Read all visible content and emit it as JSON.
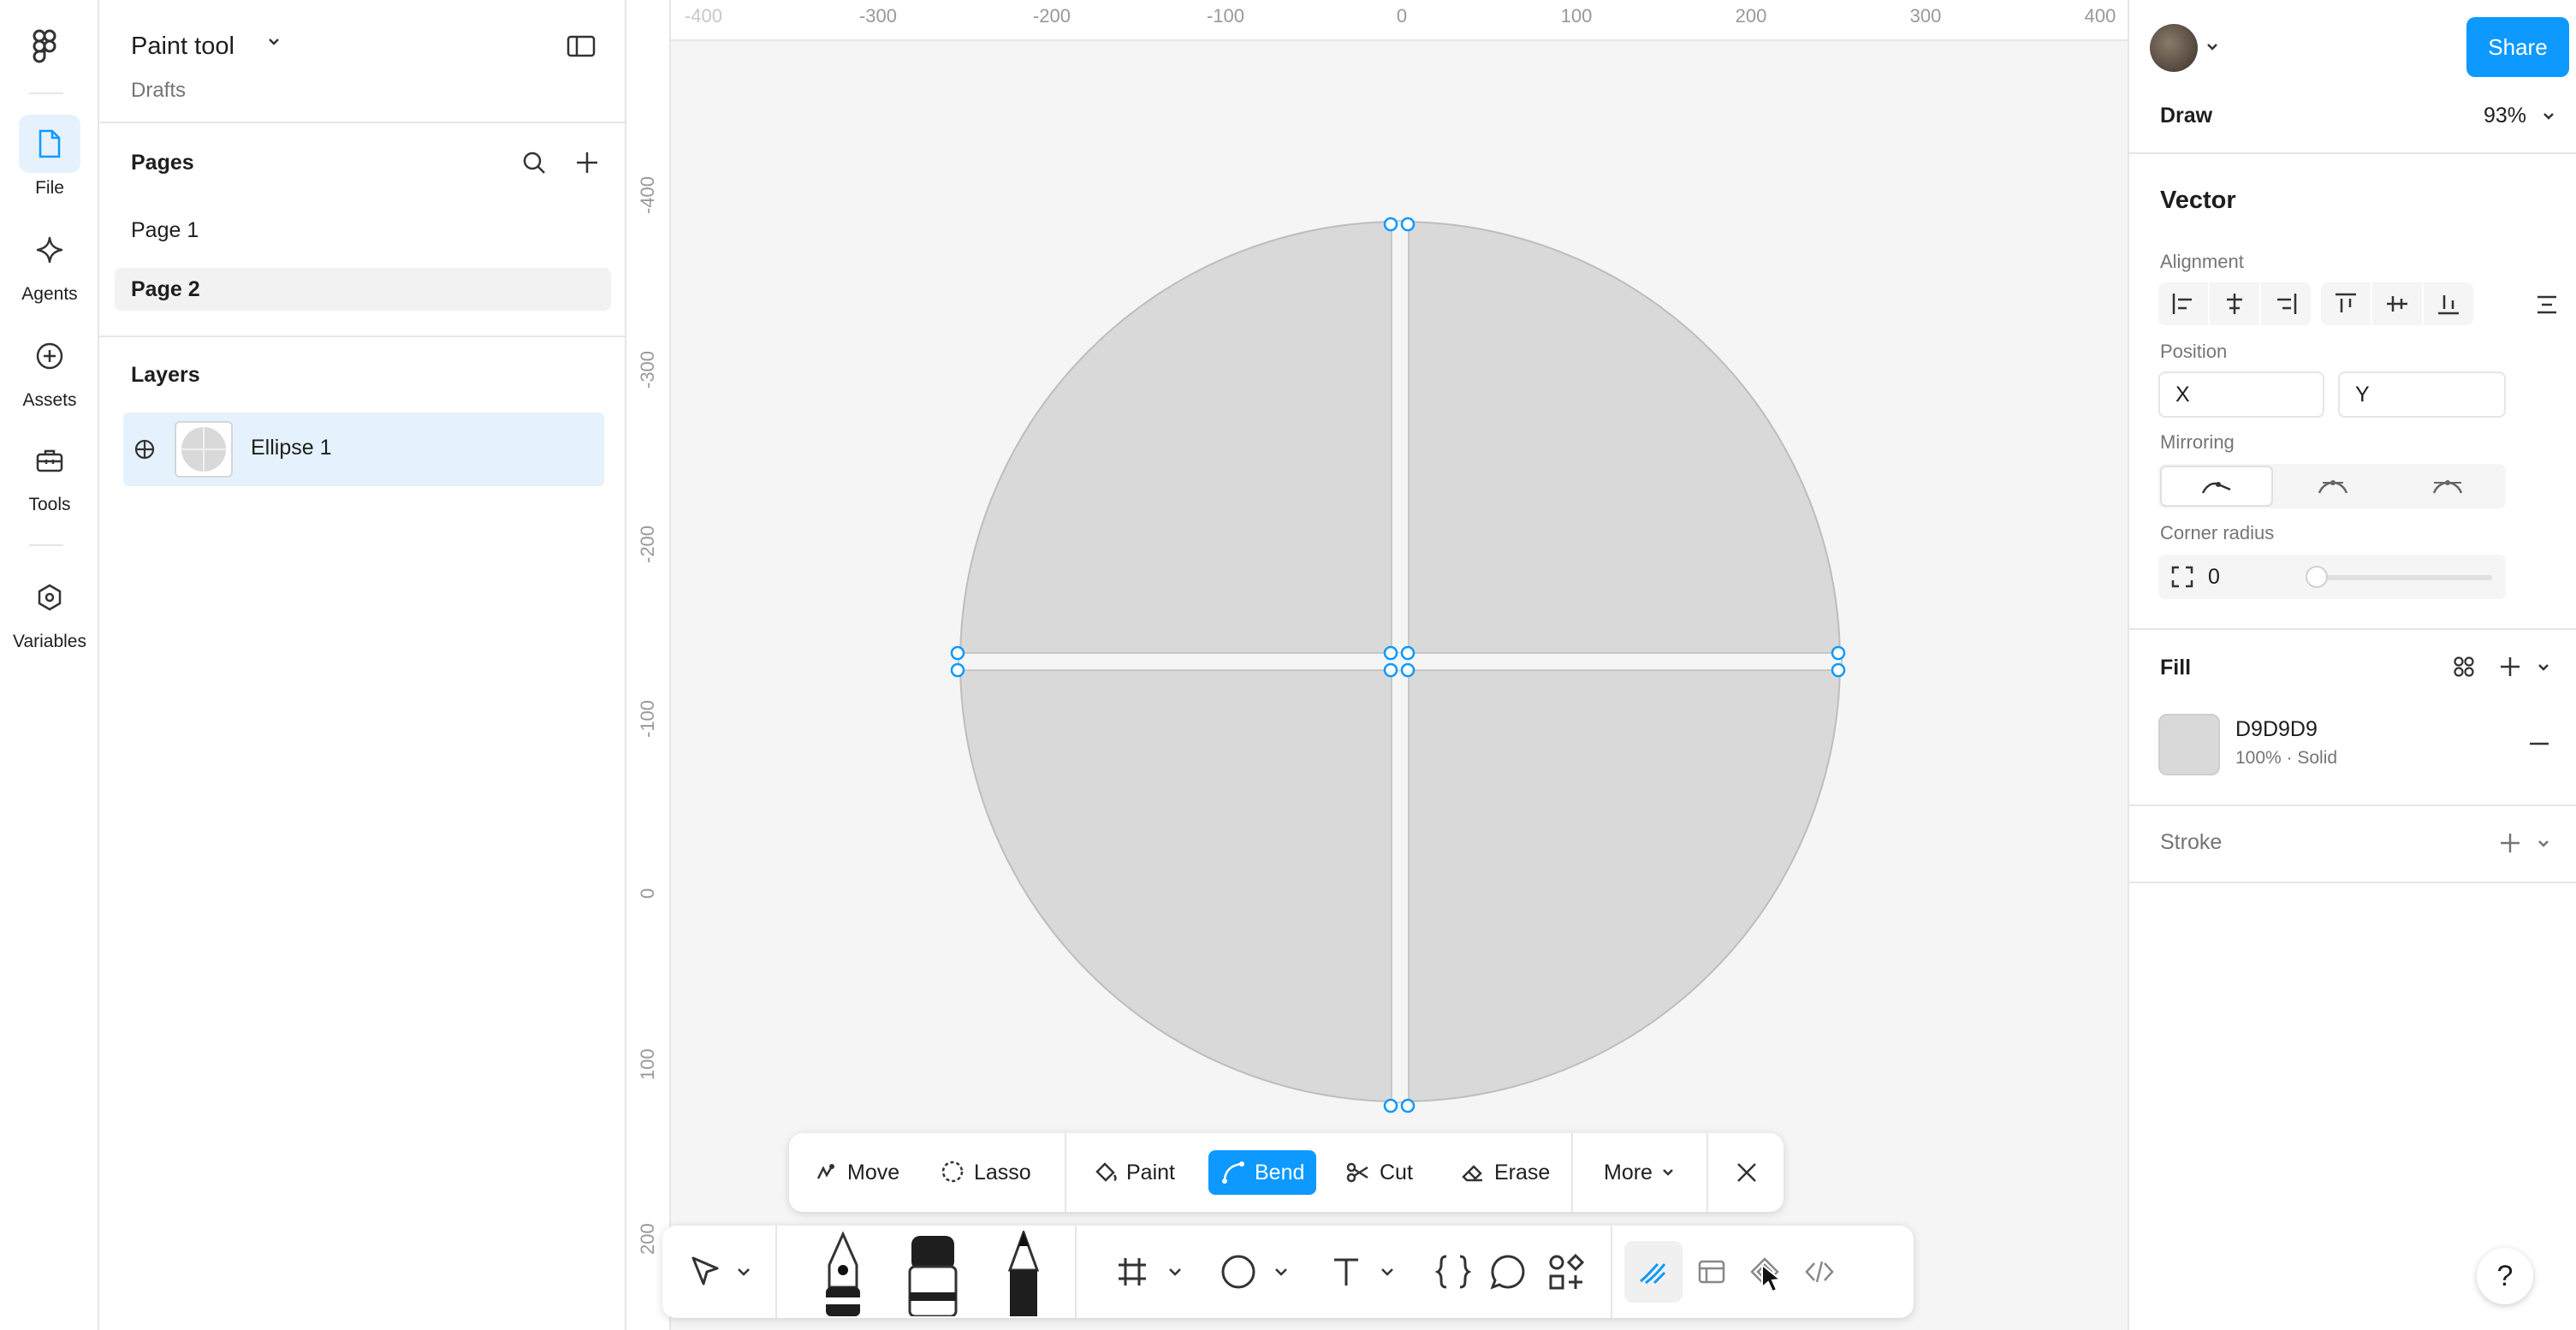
{
  "app": {
    "file_title": "Paint tool",
    "file_location": "Drafts"
  },
  "rail": {
    "items": [
      {
        "label": "File",
        "icon": "file-icon"
      },
      {
        "label": "Agents",
        "icon": "sparkle-icon"
      },
      {
        "label": "Assets",
        "icon": "plus-circle-icon"
      },
      {
        "label": "Tools",
        "icon": "toolbox-icon"
      },
      {
        "label": "Variables",
        "icon": "hexagon-icon"
      }
    ]
  },
  "pages": {
    "title": "Pages",
    "items": [
      {
        "label": "Page 1",
        "selected": false
      },
      {
        "label": "Page 2",
        "selected": true
      }
    ]
  },
  "layers": {
    "title": "Layers",
    "items": [
      {
        "label": "Ellipse 1",
        "selected": true
      }
    ]
  },
  "rulers": {
    "top": [
      "-400",
      "-300",
      "-200",
      "-100",
      "0",
      "100",
      "200",
      "300",
      "400"
    ],
    "left": [
      "-400",
      "-300",
      "-200",
      "-100",
      "0",
      "100",
      "200"
    ]
  },
  "vector_toolbar": {
    "items": [
      {
        "label": "Move",
        "icon": "move-icon",
        "active": false
      },
      {
        "label": "Lasso",
        "icon": "lasso-icon",
        "active": false
      },
      {
        "label": "Paint",
        "icon": "paint-bucket-icon",
        "active": false
      },
      {
        "label": "Bend",
        "icon": "bend-icon",
        "active": true
      },
      {
        "label": "Cut",
        "icon": "scissors-icon",
        "active": false
      },
      {
        "label": "Erase",
        "icon": "eraser-icon",
        "active": false
      },
      {
        "label": "More",
        "icon": "chevron-down-icon",
        "active": false
      }
    ]
  },
  "bottom_toolbar": {
    "tools": [
      "move-arrow-icon",
      "pen-icon",
      "marker-icon",
      "pencil-icon",
      "frame-icon",
      "ellipse-icon",
      "text-icon",
      "braces-icon",
      "comment-icon",
      "components-icon",
      "draw-mode-icon",
      "design-mode-icon",
      "prototype-icon",
      "dev-mode-icon"
    ]
  },
  "right_panel": {
    "share_label": "Share",
    "mode_label": "Draw",
    "zoom": "93%",
    "section_title": "Vector",
    "alignment_label": "Alignment",
    "position_label": "Position",
    "x_placeholder": "X",
    "y_placeholder": "Y",
    "mirroring_label": "Mirroring",
    "corner_radius_label": "Corner radius",
    "corner_radius_value": "0",
    "corner_radius_fraction": 0,
    "fill_label": "Fill",
    "fill_hex": "D9D9D9",
    "fill_detail": "100% · Solid",
    "stroke_label": "Stroke",
    "help_label": "?"
  },
  "colors": {
    "accent": "#0d99ff",
    "selection_bg": "#e5f2fd",
    "fill": "#d9d9d9"
  }
}
